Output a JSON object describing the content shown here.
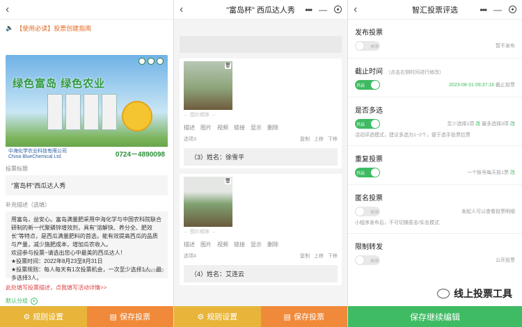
{
  "panel1": {
    "notice": "【使用必读】投票创建指南",
    "banner": {
      "slogan": "绿色富岛  绿色农业",
      "company": "中海化学农业科技有限公司",
      "company_en": "China BlueChemical Ltd.",
      "phone": "0724－4890098"
    },
    "title_label": "投票标题",
    "title_value": "\"富岛杯\"西瓜达人秀",
    "desc_label": "补充描述（选填）",
    "desc_text": "用富岛，益安心。富岛满量肥采用中海化学与中国农科院联合研制的新一代聚磷锌增效剂，具有\"溶解快、养分全、肥效长\"等特点，是西瓜满量肥料的首选，能有效提高西瓜的品质与产量，减少施肥成本，增加瓜农收入。\n欢迎参与投票~请选出您心中最美的西瓜达人！\n★投票时间：2022年8月23至8月31日\n★投票规则：每人每天有1次投票机会，一次至少选择1人，最多选择3人。",
    "desc_count": "302/3000",
    "red_link": "此处填写投票描述，点我填写活动详情>>",
    "group": "默认分组",
    "footer_left": "规则设置",
    "footer_right": "保存投票"
  },
  "panel2": {
    "title": "\"富岛杯\" 西瓜达人秀",
    "img_sort": "图片顺序",
    "tools": [
      "描述",
      "图片",
      "视频",
      "链接",
      "显示",
      "删除"
    ],
    "actions": [
      "复制",
      "上移",
      "下移"
    ],
    "options": [
      {
        "label": "选项3",
        "name": "（3）姓名：徐雪平"
      },
      {
        "label": "选项4",
        "name": "（4）姓名：艾连云"
      }
    ],
    "footer_left": "规则设置",
    "footer_right": "保存投票"
  },
  "panel3": {
    "title": "智汇投票评选",
    "publish": {
      "title": "发布投票",
      "toggle": "关闭",
      "note": "暂不发布"
    },
    "deadline": {
      "title": "截止时间",
      "hint": "（点击右侧时间进行修改）",
      "toggle": "开启",
      "date": "2023-08-31",
      "time": "09:37:16",
      "suffix": "截止投票"
    },
    "multi": {
      "title": "是否多选",
      "toggle": "开启",
      "note_a": "至少选择1项",
      "note_change": "改",
      "note_b": "最多选择3项",
      "hint": "活动评选模式，建议多选为1~2个，便于选手投票拉票"
    },
    "repeat": {
      "title": "重复投票",
      "toggle": "开启",
      "note": "一个账号每天投1票",
      "note_change": "改"
    },
    "anonymous": {
      "title": "匿名投票",
      "toggle": "关闭",
      "note": "发起人可以查看投票明细",
      "hint": "小程序发布后，不可切换匿名/实名模式"
    },
    "forward": {
      "title": "限制转发",
      "toggle": "关闭",
      "note": "公开投票"
    },
    "watermark": "线上投票工具",
    "footer": "保存继续编辑"
  }
}
